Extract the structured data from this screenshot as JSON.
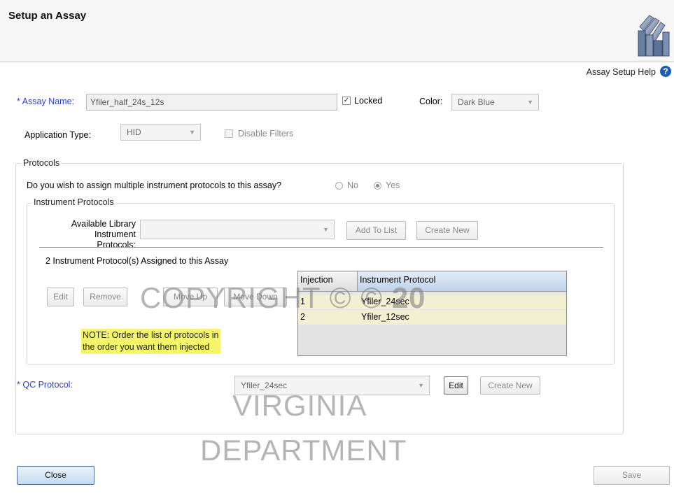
{
  "window": {
    "title": "Setup an Assay",
    "help_label": "Assay Setup Help",
    "help_glyph": "?"
  },
  "assay": {
    "required_mark": "*",
    "name_label": "Assay Name:",
    "name_value": "Yfiler_half_24s_12s",
    "locked_label": "Locked",
    "locked_checked": true,
    "color_label": "Color:",
    "color_value": "Dark Blue",
    "app_type_label": "Application Type:",
    "app_type_value": "HID",
    "disable_filters_label": "Disable Filters",
    "disable_filters_checked": false
  },
  "protocols": {
    "group_label": "Protocols",
    "multi_question": "Do you wish to assign multiple instrument protocols to this assay?",
    "no_label": "No",
    "yes_label": "Yes",
    "selected": "Yes",
    "instrument_group_label": "Instrument Protocols",
    "available_label_line1": "Available Library",
    "available_label_line2": "Instrument Protocols:",
    "available_value": "",
    "add_to_list": "Add To List",
    "create_new": "Create New",
    "assigned_caption": "2 Instrument Protocol(s) Assigned to this Assay",
    "edit": "Edit",
    "remove": "Remove",
    "move_up": "Move Up",
    "move_down": "Move Down",
    "note_line1": "NOTE: Order the list of protocols in",
    "note_line2": "the order you want them injected",
    "table": {
      "columns": [
        "Injection",
        "Instrument Protocol"
      ],
      "rows": [
        {
          "injection": "1",
          "protocol": "Yfiler_24sec"
        },
        {
          "injection": "2",
          "protocol": "Yfiler_12sec"
        }
      ]
    }
  },
  "qc": {
    "required_mark": "*",
    "label": "QC Protocol:",
    "value": "Yfiler_24sec",
    "edit": "Edit",
    "create_new": "Create New"
  },
  "footer": {
    "close": "Close",
    "save": "Save"
  },
  "watermark": {
    "line1_prefix": "COPYRIGHT © 20",
    "line1_bold": "20",
    "line2": "VIRGINIA",
    "line3": "DEPARTMENT"
  },
  "colors": {
    "required_label": "#2a3fc7",
    "note_bg": "#f5f56a",
    "table_row_bg": "#f2f0d2",
    "header_sel": "#bfd2ea"
  },
  "icons": {
    "logo": "stacked-books-logo",
    "combo_arrow": "chevron-down-icon"
  }
}
